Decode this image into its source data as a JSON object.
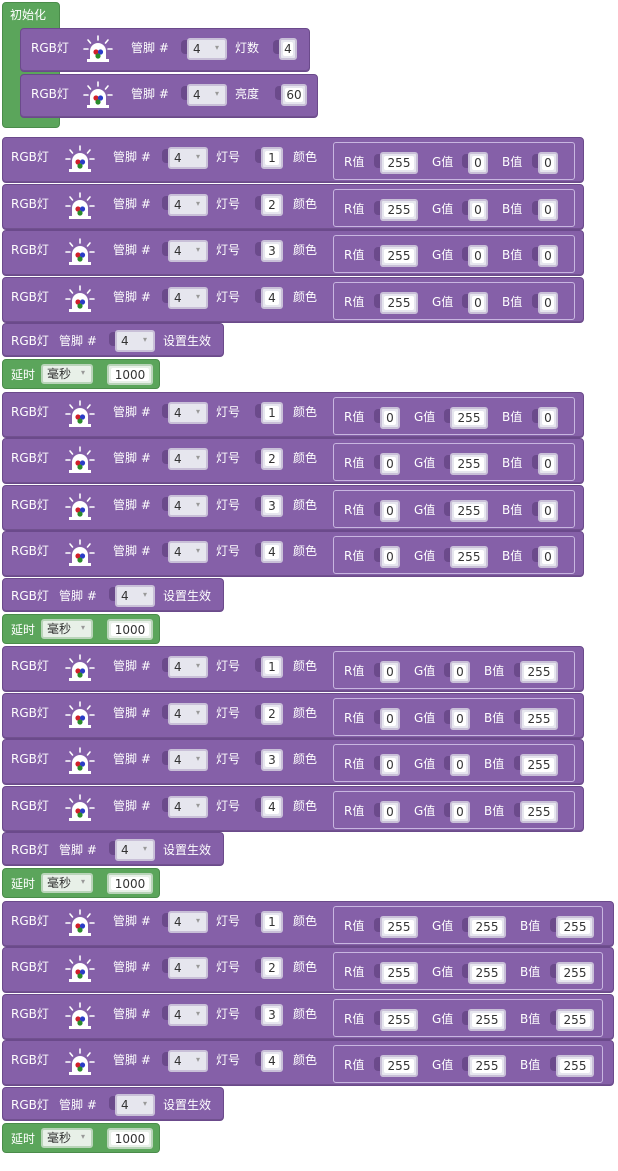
{
  "init": {
    "title": "初始化",
    "rows": [
      {
        "rgb": "RGB灯",
        "pin_label": "管脚 #",
        "pin": "4",
        "param_label": "灯数",
        "param": "4"
      },
      {
        "rgb": "RGB灯",
        "pin_label": "管脚 #",
        "pin": "4",
        "param_label": "亮度",
        "param": "60"
      }
    ]
  },
  "labels": {
    "rgb": "RGB灯",
    "pin": "管脚 #",
    "lamp": "灯号",
    "color": "颜色",
    "r": "R值",
    "g": "G值",
    "b": "B值",
    "apply": "设置生效",
    "delay": "延时",
    "unit": "毫秒"
  },
  "groups": [
    {
      "pin": "4",
      "rgb": [
        [
          "255",
          "0",
          "0"
        ],
        [
          "255",
          "0",
          "0"
        ],
        [
          "255",
          "0",
          "0"
        ],
        [
          "255",
          "0",
          "0"
        ]
      ],
      "lamps": [
        "1",
        "2",
        "3",
        "4"
      ],
      "delay": "1000"
    },
    {
      "pin": "4",
      "rgb": [
        [
          "0",
          "255",
          "0"
        ],
        [
          "0",
          "255",
          "0"
        ],
        [
          "0",
          "255",
          "0"
        ],
        [
          "0",
          "255",
          "0"
        ]
      ],
      "lamps": [
        "1",
        "2",
        "3",
        "4"
      ],
      "delay": "1000"
    },
    {
      "pin": "4",
      "rgb": [
        [
          "0",
          "0",
          "255"
        ],
        [
          "0",
          "0",
          "255"
        ],
        [
          "0",
          "0",
          "255"
        ],
        [
          "0",
          "0",
          "255"
        ]
      ],
      "lamps": [
        "1",
        "2",
        "3",
        "4"
      ],
      "delay": "1000"
    },
    {
      "pin": "4",
      "rgb": [
        [
          "255",
          "255",
          "255"
        ],
        [
          "255",
          "255",
          "255"
        ],
        [
          "255",
          "255",
          "255"
        ],
        [
          "255",
          "255",
          "255"
        ]
      ],
      "lamps": [
        "1",
        "2",
        "3",
        "4"
      ],
      "delay": "1000"
    }
  ],
  "colors": {
    "block_purple": "#8560a8",
    "block_green": "#5ba55b"
  },
  "icons": [
    "rgb-led-icon"
  ]
}
